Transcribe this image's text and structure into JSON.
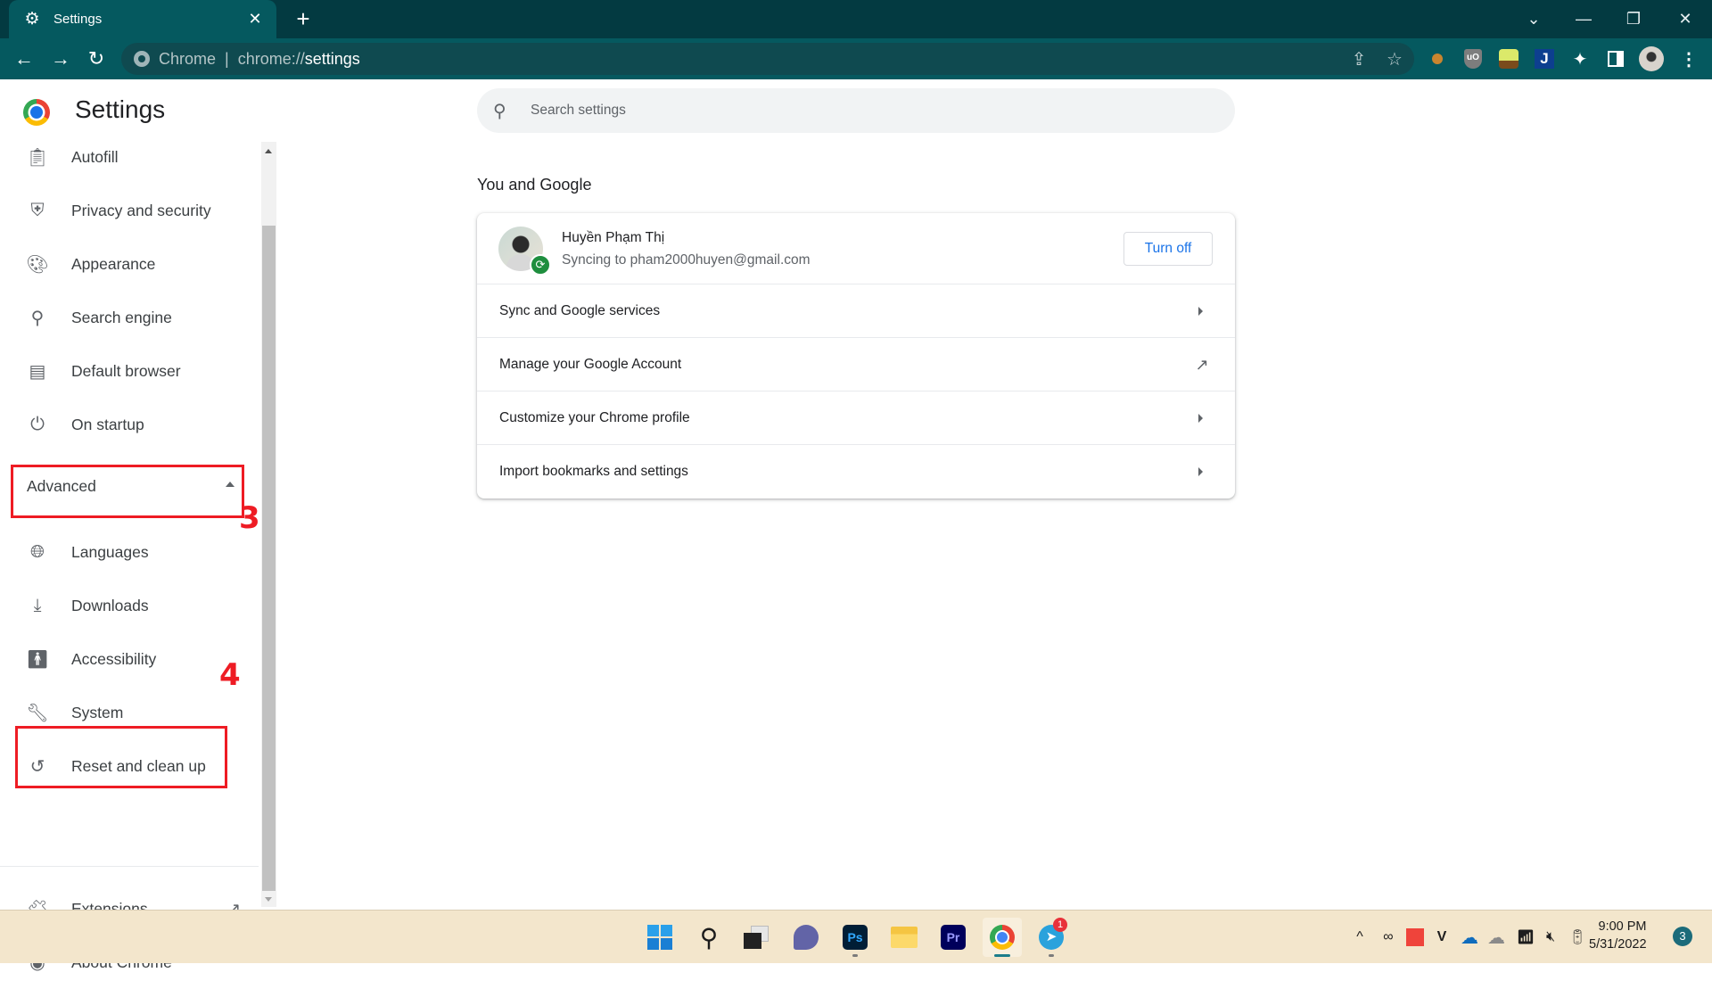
{
  "browser": {
    "tab": {
      "title": "Settings",
      "icon": "gear-icon",
      "close": "✕"
    },
    "new_tab": "+",
    "window_controls": {
      "tab_search": "⌄",
      "minimize": "—",
      "restore": "❐",
      "close": "✕"
    },
    "nav": {
      "back": "←",
      "forward": "→",
      "reload": "↻"
    },
    "omnibox": {
      "site_label": "Chrome",
      "separator": "|",
      "url_prefix": "chrome://",
      "url_path": "settings"
    },
    "omnibox_actions": {
      "share": "⇪",
      "bookmark": "☆"
    },
    "extensions": [
      "cookie-extension",
      "ublock-origin",
      "forest-extension",
      "j-extension",
      "extensions-puzzle",
      "side-panel",
      "profile-avatar",
      "chrome-menu"
    ]
  },
  "settings": {
    "title": "Settings",
    "search": {
      "placeholder": "Search settings",
      "value": ""
    },
    "sidebar": {
      "items": [
        {
          "label": "Autofill",
          "icon": "clipboard-icon"
        },
        {
          "label": "Privacy and security",
          "icon": "shield-icon"
        },
        {
          "label": "Appearance",
          "icon": "palette-icon"
        },
        {
          "label": "Search engine",
          "icon": "search-icon"
        },
        {
          "label": "Default browser",
          "icon": "browser-window-icon"
        },
        {
          "label": "On startup",
          "icon": "power-icon"
        }
      ],
      "advanced": {
        "label": "Advanced",
        "expanded": true
      },
      "advanced_items": [
        {
          "label": "Languages",
          "icon": "globe-icon"
        },
        {
          "label": "Downloads",
          "icon": "download-icon"
        },
        {
          "label": "Accessibility",
          "icon": "accessibility-icon"
        },
        {
          "label": "System",
          "icon": "wrench-icon"
        },
        {
          "label": "Reset and clean up",
          "icon": "history-reset-icon"
        }
      ],
      "footer_items": [
        {
          "label": "Extensions",
          "icon": "puzzle-icon",
          "trailing": "open-in-new-icon"
        },
        {
          "label": "About Chrome",
          "icon": "chrome-icon"
        }
      ]
    },
    "annotations": {
      "step_3": "3",
      "step_4": "4"
    },
    "section": {
      "title": "You and Google",
      "profile": {
        "name": "Huyền Phạm Thị",
        "status": "Syncing to pham2000huyen@gmail.com",
        "turn_off_label": "Turn off"
      },
      "rows": [
        {
          "label": "Sync and Google services",
          "trailing": "chevron"
        },
        {
          "label": "Manage your Google Account",
          "trailing": "external"
        },
        {
          "label": "Customize your Chrome profile",
          "trailing": "chevron"
        },
        {
          "label": "Import bookmarks and settings",
          "trailing": "chevron"
        }
      ]
    }
  },
  "taskbar": {
    "apps": [
      "Start",
      "Search",
      "Task View",
      "Teams Chat",
      "Ps",
      "File Explorer",
      "Pr",
      "Chrome",
      "Telegram"
    ],
    "telegram_badge": "1",
    "tray": {
      "overflow": "^",
      "mute": "🔇"
    },
    "clock": {
      "time": "9:00 PM",
      "date": "5/31/2022"
    },
    "notifications": "3"
  },
  "colors": {
    "titlebar": "#033a41",
    "toolbar": "#05595f",
    "annotation_red": "#ee1c24",
    "accent_blue": "#1a73e8",
    "sync_green": "#1e8e3e"
  }
}
